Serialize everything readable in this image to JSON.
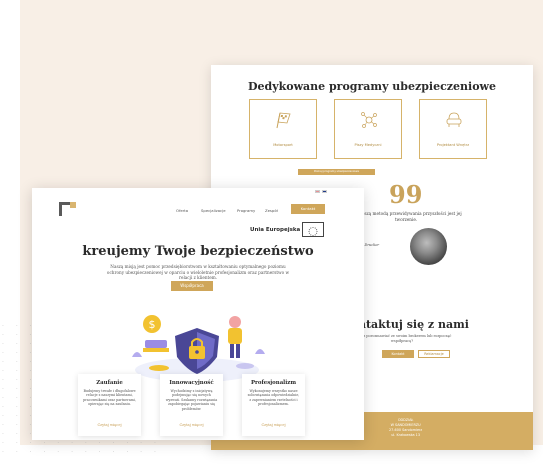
{
  "back_page": {
    "section_title": "Dedykowane programy ubezpieczeniowe",
    "programs": [
      {
        "label": "Motorsport",
        "icon": "racing-flag-icon"
      },
      {
        "label": "Piszy Medyczni",
        "icon": "molecule-icon"
      },
      {
        "label": "Projektant Wnętrz",
        "icon": "armchair-icon"
      }
    ],
    "programs_button": "Poznaj programy ubezpieczeniowe",
    "quote_mark": "99",
    "quote_text": "Najlepszą metodą przewidywania przyszłości jest jej tworzenie.",
    "quote_author": "Peter Drucker",
    "contact_title": "Skontaktuj się z nami",
    "contact_subtitle": "Chcesz porozmawiać ze swoim brokerem lub rozpocząć współpracę?",
    "contact_button_primary": "Kontakt",
    "contact_button_secondary": "Reklamacje",
    "footer": [
      {
        "line1": "ODDZIAŁ",
        "line2": "W TYCHACH",
        "line3": "43-100 Tychy",
        "line4": "ul. Budzika 41"
      },
      {
        "line1": "ODDZIAŁ",
        "line2": "W SANDOMIERZU",
        "line3": "27-600 Sandomierz",
        "line4": "ul. Krakowska 13"
      }
    ]
  },
  "front_page": {
    "nav": [
      "Oferta",
      "Specjalizacje",
      "Programy",
      "Zespół"
    ],
    "nav_cta": "Kontakt",
    "eu_label": "Unia Europejska",
    "hero_title": "kreujemy Twoje bezpieczeństwo",
    "hero_subtitle": "Naszą misją jest pomoc przedsiębiorstwom w kształtowaniu optymalnego poziomu ochrony ubezpieczeniowej w oparciu o wieloletnie profesjonalizm oraz partnerstwo w relacji z klientem.",
    "hero_button": "Współpraca",
    "features": [
      {
        "title": "Zaufanie",
        "text": "Budujemy trwałe i długofalowe relacje z naszymi klientami, pracownikami oraz partnerami, opierając się na zaufaniu.",
        "link": "Czytaj więcej"
      },
      {
        "title": "Innowacyjność",
        "text": "Wychodzimy z inicjatywą podejmując się nowych wyzwań. Szukamy rozwiązania zapobiegając pojawianiu się problemów.",
        "link": "Czytaj więcej"
      },
      {
        "title": "Profesjonalizm",
        "text": "Wykonujemy wszystko nasze zobowiązania odpowiedzialnie, z zapewnianiem rzetelności i profesjonalizmem.",
        "link": "Czytaj więcej"
      }
    ]
  },
  "colors": {
    "accent": "#cfa65a",
    "background": "#f8efe6",
    "footer": "#d4ad63"
  }
}
